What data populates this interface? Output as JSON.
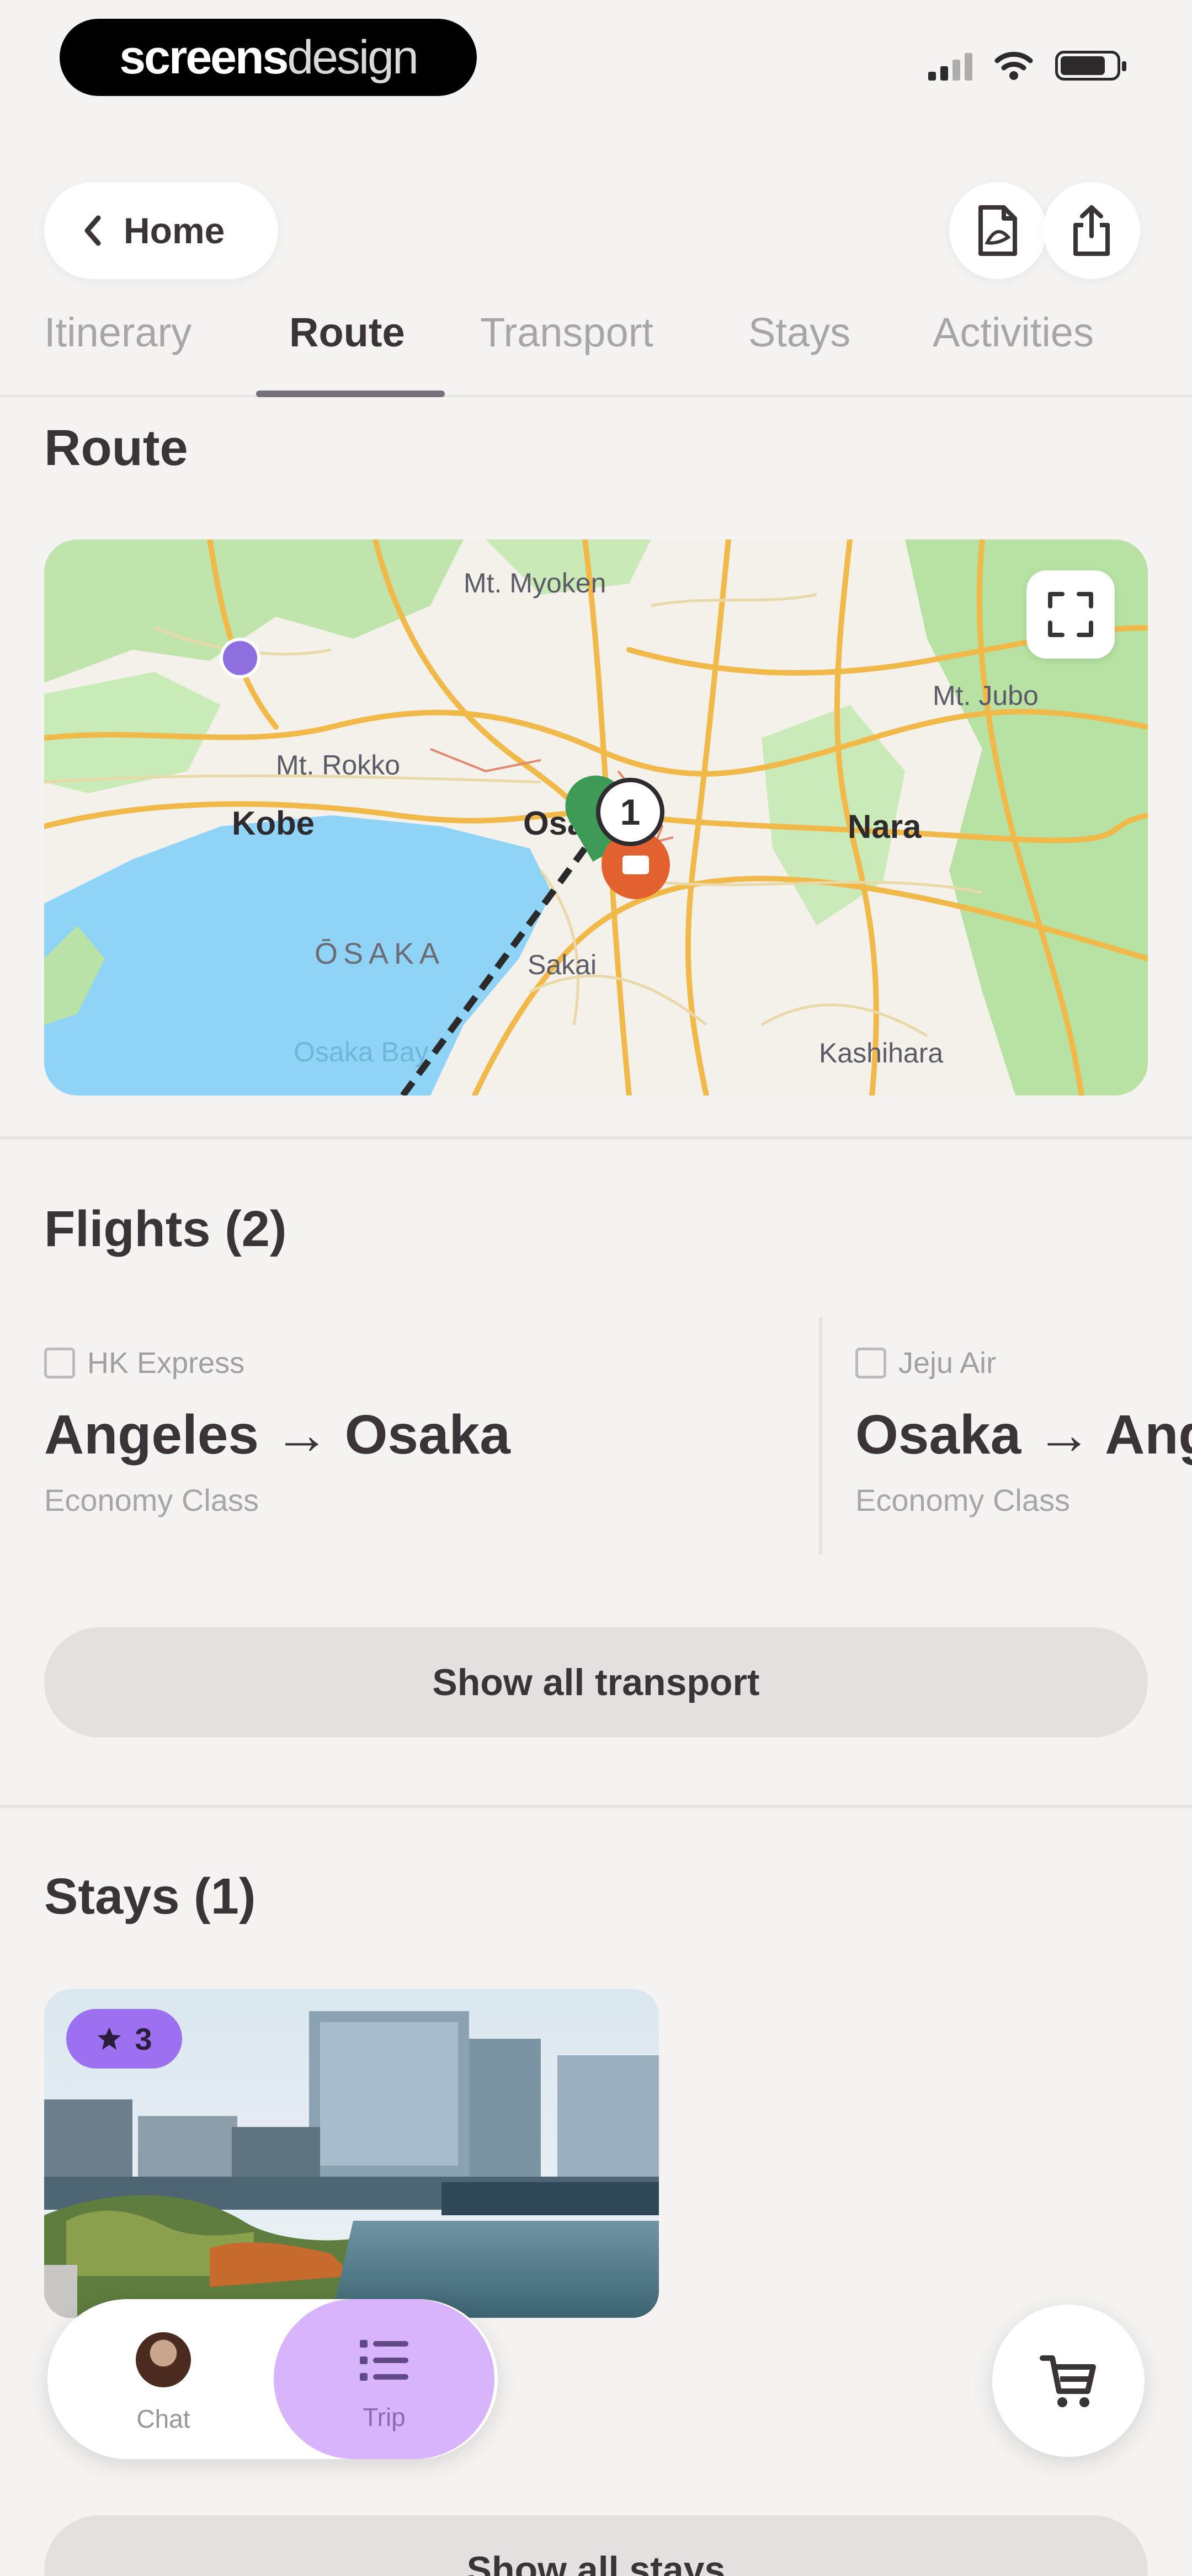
{
  "status_bar": {
    "brand_bold": "screens",
    "brand_light": "design"
  },
  "header": {
    "back_label": "Home",
    "pdf_icon": "document-pdf-icon",
    "share_icon": "share-icon"
  },
  "tabs": [
    {
      "label": "Itinerary"
    },
    {
      "label": "Route",
      "active": true
    },
    {
      "label": "Transport"
    },
    {
      "label": "Stays"
    },
    {
      "label": "Activities"
    }
  ],
  "route": {
    "title": "Route",
    "map_labels": {
      "kobe": "Kobe",
      "osaka_city": "Osaka",
      "nara": "Nara",
      "osaka_sea": "ŌSAKA",
      "sakai": "Sakai",
      "mt_rokko": "Mt. Rokko",
      "mt_myoken": "Mt. Myoken",
      "mt_jubo": "Mt. Jubo",
      "kashihara": "Kashihara",
      "osaka_bay": "Osaka Bay"
    },
    "pin_number": "1",
    "colors": {
      "water": "#8fd3f7",
      "park": "#b9e3a6",
      "road": "#f0b949",
      "pin_green": "#3d9a57",
      "pin_orange": "#e2612e"
    }
  },
  "flights": {
    "title": "Flights (2)",
    "items": [
      {
        "airline": "HK Express",
        "route": "Angeles → Osaka",
        "class": "Economy Class"
      },
      {
        "airline": "Jeju Air",
        "route": "Osaka → Angeles",
        "class": "Economy Class"
      }
    ],
    "show_all_label": "Show all transport"
  },
  "stays": {
    "title": "Stays (1)",
    "badge_rating": "3",
    "show_all_label": "Show all stays"
  },
  "bottom_nav": {
    "items": [
      {
        "label": "Chat",
        "icon": "avatar"
      },
      {
        "label": "Trip",
        "icon": "list-icon",
        "active": true
      }
    ],
    "cart_icon": "cart-icon"
  }
}
